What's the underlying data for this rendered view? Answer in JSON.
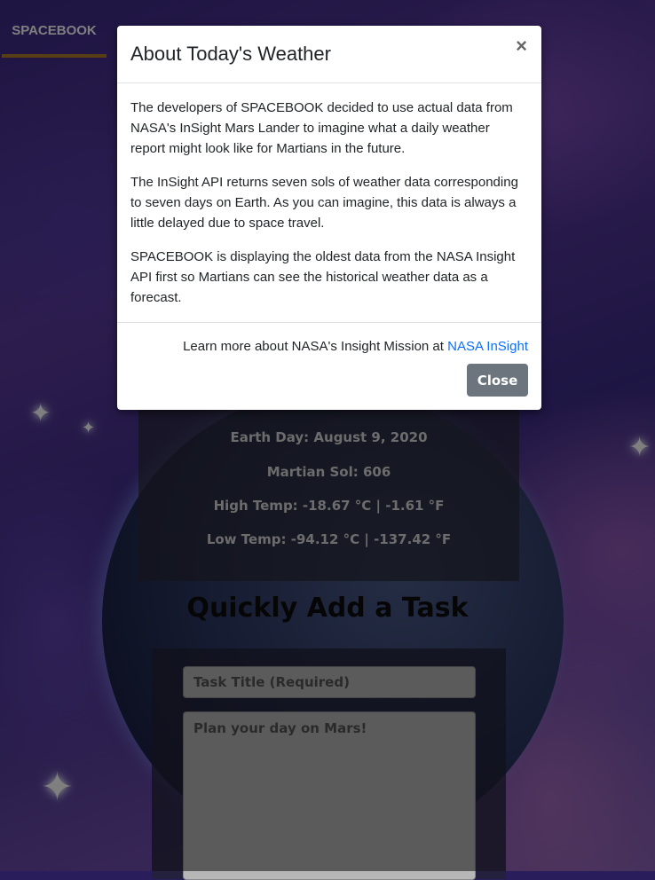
{
  "navbar": {
    "brand": "SPACEBOOK"
  },
  "weather": {
    "earth_day": "Earth Day: August 9, 2020",
    "martian_sol": "Martian Sol: 606",
    "high_temp": "High Temp: -18.67 °C | -1.61 °F",
    "low_temp": "Low Temp: -94.12 °C | -137.42 °F"
  },
  "task": {
    "heading": "Quickly Add a Task",
    "title_placeholder": "Task Title (Required)",
    "body_placeholder": "Plan your day on Mars!"
  },
  "modal": {
    "title": "About Today's Weather",
    "close_icon": "×",
    "paragraphs": [
      "The developers of SPACEBOOK decided to use actual data from NASA's InSight Mars Lander to imagine what a daily weather report might look like for Martians in the future.",
      "The InSight API returns seven sols of weather data corresponding to seven days on Earth. As you can imagine, this data is always a little delayed due to space travel.",
      "SPACEBOOK is displaying the oldest data from the NASA Insight API first so Martians can see the historical weather data as a forecast."
    ],
    "learn_more_text": "Learn more about NASA's Insight Mission at ",
    "learn_more_link": "NASA InSight",
    "close_button": "Close"
  },
  "colors": {
    "link": "#0d6efd",
    "close_button_bg": "#6c757d",
    "brand_underline": "#b07a2a"
  }
}
